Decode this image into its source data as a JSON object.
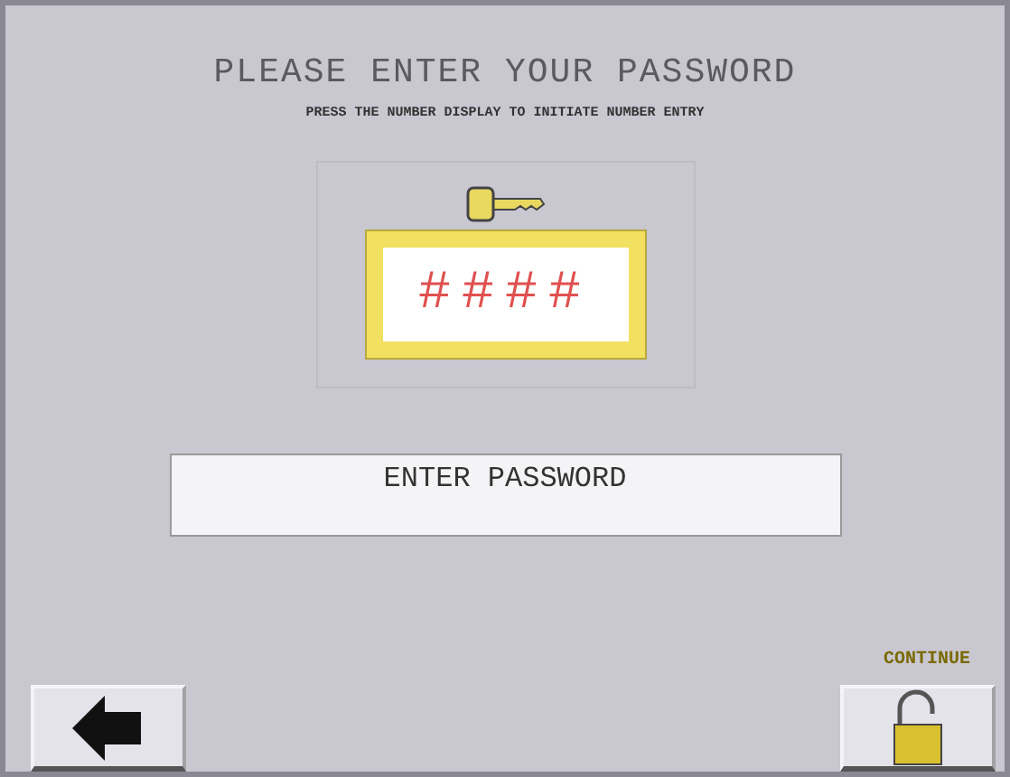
{
  "title": "PLEASE ENTER YOUR PASSWORD",
  "subtitle": "PRESS THE NUMBER DISPLAY TO INITIATE NUMBER ENTRY",
  "number_display": "####",
  "password_field": "ENTER PASSWORD",
  "continue_label": "CONTINUE"
}
